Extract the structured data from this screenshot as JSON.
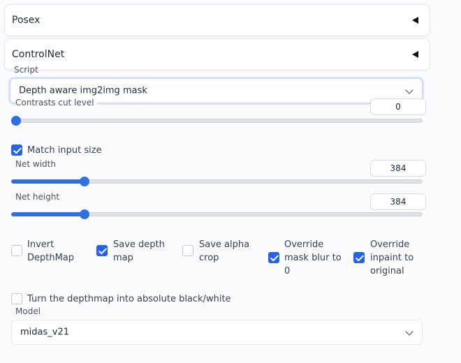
{
  "accordions": {
    "posex": {
      "title": "Posex"
    },
    "controlnet": {
      "title": "ControlNet"
    }
  },
  "script": {
    "label": "Script",
    "selected": "Depth aware img2img mask"
  },
  "contrasts": {
    "label": "Contrasts cut level",
    "value": "0",
    "fraction": 0.0
  },
  "match_input_size": {
    "label": "Match input size",
    "checked": true
  },
  "net_width": {
    "label": "Net width",
    "value": "384",
    "fraction": 0.17
  },
  "net_height": {
    "label": "Net height",
    "value": "384",
    "fraction": 0.17
  },
  "options": [
    {
      "line1": "Invert",
      "line2": "DepthMap",
      "line3": "",
      "checked": false
    },
    {
      "line1": "Save depth",
      "line2": "map",
      "line3": "",
      "checked": true
    },
    {
      "line1": "Save alpha",
      "line2": "crop",
      "line3": "",
      "checked": false
    },
    {
      "line1": "Override",
      "line2": "mask blur to",
      "line3": "0",
      "checked": true
    },
    {
      "line1": "Override",
      "line2": "inpaint to",
      "line3": "original",
      "checked": true
    }
  ],
  "absolute_bw": {
    "label": "Turn the depthmap into absolute black/white",
    "checked": false
  },
  "model": {
    "label": "Model",
    "selected": "midas_v21"
  },
  "colors": {
    "accent": "#2563eb",
    "track": "#dfe1e6",
    "background": "#fbfbfe"
  }
}
